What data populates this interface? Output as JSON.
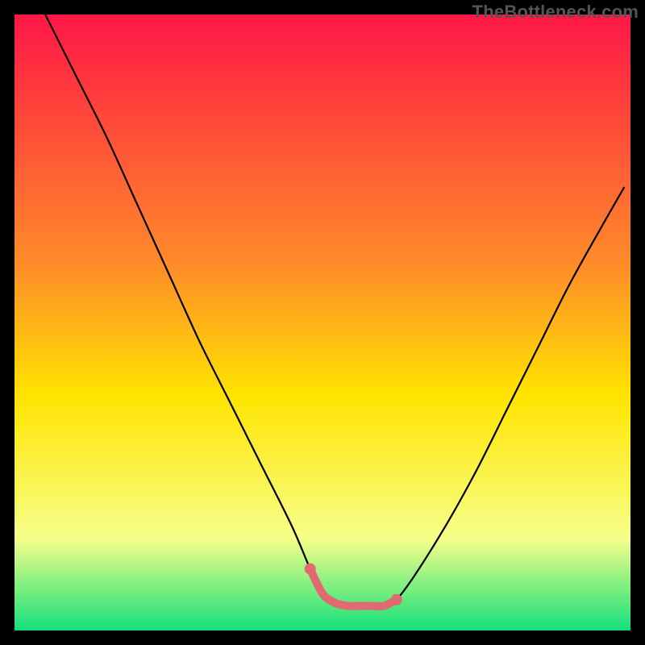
{
  "attribution": "TheBottleneck.com",
  "chart_data": {
    "type": "line",
    "title": "",
    "xlabel": "",
    "ylabel": "",
    "xlim": [
      0,
      100
    ],
    "ylim": [
      0,
      100
    ],
    "background_gradient": {
      "top": "#ff1746",
      "mid1": "#ff8a2a",
      "mid2": "#ffe400",
      "mid3": "#f7ff8a",
      "bottom": "#13e07a"
    },
    "series": [
      {
        "name": "bottleneck-curve",
        "color": "#000000",
        "x": [
          5,
          10,
          15,
          20,
          25,
          30,
          35,
          40,
          45,
          48,
          50,
          55,
          60,
          62,
          65,
          70,
          75,
          80,
          85,
          90,
          95,
          99
        ],
        "y": [
          100,
          90,
          80,
          69,
          58,
          47,
          37,
          27,
          17,
          10,
          6,
          4,
          4,
          5,
          9,
          17,
          26,
          36,
          46,
          56,
          65,
          72
        ]
      }
    ],
    "highlight": {
      "name": "optimal-zone",
      "color": "#e06a6f",
      "x": [
        48,
        50,
        52,
        54,
        56,
        58,
        60,
        62
      ],
      "y": [
        10,
        6,
        4.5,
        4,
        4,
        4,
        4,
        5
      ]
    }
  }
}
